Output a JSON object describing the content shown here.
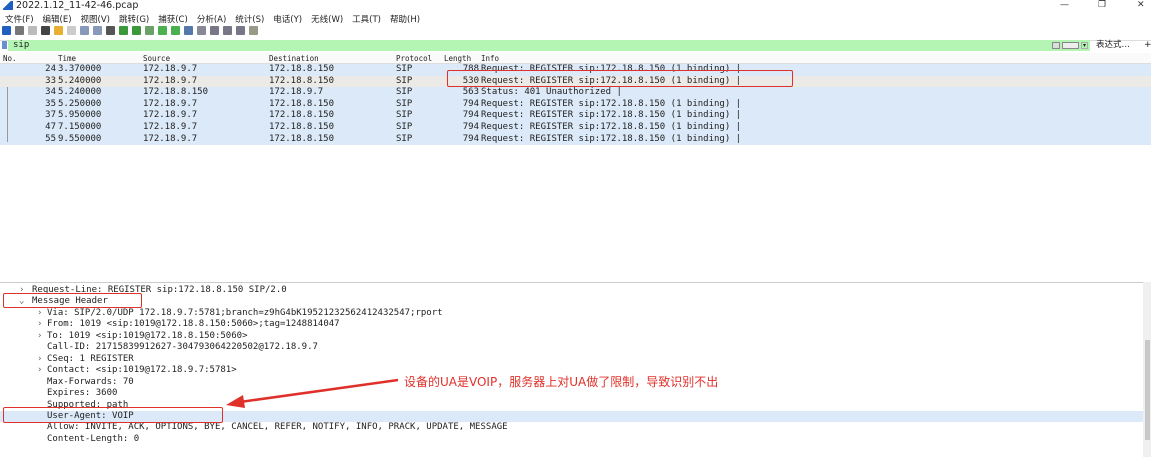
{
  "window": {
    "title": "2022.1.12_11-42-46.pcap",
    "minimize": "—",
    "restore": "❐",
    "close": "✕"
  },
  "menu": [
    "文件(F)",
    "编辑(E)",
    "视图(V)",
    "跳转(G)",
    "捕获(C)",
    "分析(A)",
    "统计(S)",
    "电话(Y)",
    "无线(W)",
    "工具(T)",
    "帮助(H)"
  ],
  "toolbar_icons": [
    "shark-fin-start-icon",
    "stop-icon",
    "restart-icon",
    "options-icon",
    "open-icon",
    "save-icon",
    "close-file-icon",
    "reload-icon",
    "find-icon",
    "back-icon",
    "forward-icon",
    "goto-icon",
    "first-icon",
    "last-icon",
    "autoscroll-icon",
    "colorize-icon",
    "zoom-in-icon",
    "zoom-out-icon",
    "zoom-normal-icon",
    "resize-columns-icon"
  ],
  "filter": {
    "value": "sip",
    "expression_label": "表达式…",
    "plus": "+"
  },
  "columns": [
    "No.",
    "Time",
    "Source",
    "Destination",
    "Protocol",
    "Length",
    "Info"
  ],
  "packets": [
    {
      "no": "24",
      "time": "3.370000",
      "src": "172.18.9.7",
      "dst": "172.18.8.150",
      "proto": "SIP",
      "len": "788",
      "info": "Request: REGISTER sip:172.18.8.150  (1 binding) |"
    },
    {
      "no": "33",
      "time": "5.240000",
      "src": "172.18.9.7",
      "dst": "172.18.8.150",
      "proto": "SIP",
      "len": "530",
      "info": "Request: REGISTER sip:172.18.8.150  (1 binding) |"
    },
    {
      "no": "34",
      "time": "5.240000",
      "src": "172.18.8.150",
      "dst": "172.18.9.7",
      "proto": "SIP",
      "len": "563",
      "info": "Status: 401 Unauthorized |"
    },
    {
      "no": "35",
      "time": "5.250000",
      "src": "172.18.9.7",
      "dst": "172.18.8.150",
      "proto": "SIP",
      "len": "794",
      "info": "Request: REGISTER sip:172.18.8.150  (1 binding) |"
    },
    {
      "no": "37",
      "time": "5.950000",
      "src": "172.18.9.7",
      "dst": "172.18.8.150",
      "proto": "SIP",
      "len": "794",
      "info": "Request: REGISTER sip:172.18.8.150  (1 binding) |"
    },
    {
      "no": "47",
      "time": "7.150000",
      "src": "172.18.9.7",
      "dst": "172.18.8.150",
      "proto": "SIP",
      "len": "794",
      "info": "Request: REGISTER sip:172.18.8.150  (1 binding) |"
    },
    {
      "no": "55",
      "time": "9.550000",
      "src": "172.18.9.7",
      "dst": "172.18.8.150",
      "proto": "SIP",
      "len": "794",
      "info": "Request: REGISTER sip:172.18.8.150  (1 binding) |"
    }
  ],
  "details": [
    {
      "arrow": ">",
      "text": "Request-Line: REGISTER sip:172.18.8.150 SIP/2.0",
      "indent": 0
    },
    {
      "arrow": "v",
      "text": "Message Header",
      "indent": 0
    },
    {
      "arrow": ">",
      "text": "Via: SIP/2.0/UDP 172.18.9.7:5781;branch=z9hG4bK19521232562412432547;rport",
      "indent": 1
    },
    {
      "arrow": ">",
      "text": "From: 1019 <sip:1019@172.18.8.150:5060>;tag=1248814047",
      "indent": 1
    },
    {
      "arrow": ">",
      "text": "To: 1019 <sip:1019@172.18.8.150:5060>",
      "indent": 1
    },
    {
      "arrow": "",
      "text": "Call-ID: 21715839912627-304793064220502@172.18.9.7",
      "indent": 1
    },
    {
      "arrow": ">",
      "text": "CSeq: 1 REGISTER",
      "indent": 1
    },
    {
      "arrow": ">",
      "text": "Contact: <sip:1019@172.18.9.7:5781>",
      "indent": 1
    },
    {
      "arrow": "",
      "text": "Max-Forwards: 70",
      "indent": 1
    },
    {
      "arrow": "",
      "text": "Expires: 3600",
      "indent": 1
    },
    {
      "arrow": "",
      "text": "Supported: path",
      "indent": 1
    },
    {
      "arrow": "",
      "text": "User-Agent: VOIP",
      "indent": 1
    },
    {
      "arrow": "",
      "text": "Allow: INVITE, ACK, OPTIONS, BYE, CANCEL, REFER, NOTIFY, INFO, PRACK, UPDATE, MESSAGE",
      "indent": 1
    },
    {
      "arrow": "",
      "text": "Content-Length: 0",
      "indent": 1
    }
  ],
  "annotation": {
    "text": "设备的UA是VOIP，服务器上对UA做了限制，导致识别不出",
    "color": "#e0302a"
  },
  "colors": {
    "row": "#dbe9f8",
    "filter": "#b4f5b4",
    "annotation": "#e0302a"
  }
}
